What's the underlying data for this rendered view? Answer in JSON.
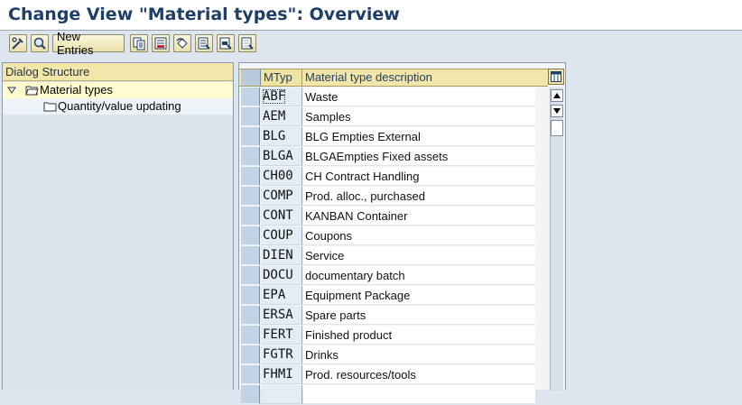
{
  "window": {
    "title": "Change View \"Material types\": Overview"
  },
  "toolbar": {
    "new_entries_label": "New Entries",
    "icons": [
      "display-change-icon",
      "details-icon",
      "new-entries-button",
      "copy-as-icon",
      "delete-icon",
      "undo-change-icon",
      "select-all-icon",
      "select-block-icon",
      "deselect-all-icon"
    ]
  },
  "dialog_structure": {
    "header": "Dialog Structure",
    "items": [
      {
        "label": "Material types",
        "selected": true,
        "expanded": true
      },
      {
        "label": "Quantity/value updating",
        "selected": false
      }
    ]
  },
  "table": {
    "columns": [
      "MTyp",
      "Material type description"
    ],
    "rows": [
      {
        "code": "ABF",
        "desc": "Waste"
      },
      {
        "code": "AEM",
        "desc": "Samples"
      },
      {
        "code": "BLG",
        "desc": "BLG Empties  External"
      },
      {
        "code": "BLGA",
        "desc": "BLGAEmpties  Fixed assets"
      },
      {
        "code": "CH00",
        "desc": "CH Contract Handling"
      },
      {
        "code": "COMP",
        "desc": "Prod. alloc., purchased"
      },
      {
        "code": "CONT",
        "desc": "KANBAN Container"
      },
      {
        "code": "COUP",
        "desc": "Coupons"
      },
      {
        "code": "DIEN",
        "desc": "Service"
      },
      {
        "code": "DOCU",
        "desc": "documentary batch"
      },
      {
        "code": "EPA",
        "desc": "Equipment Package"
      },
      {
        "code": "ERSA",
        "desc": "Spare parts"
      },
      {
        "code": "FERT",
        "desc": "Finished product"
      },
      {
        "code": "FGTR",
        "desc": "Drinks"
      },
      {
        "code": "FHMI",
        "desc": "Prod. resources/tools"
      },
      {
        "code": "",
        "desc": ""
      }
    ]
  }
}
